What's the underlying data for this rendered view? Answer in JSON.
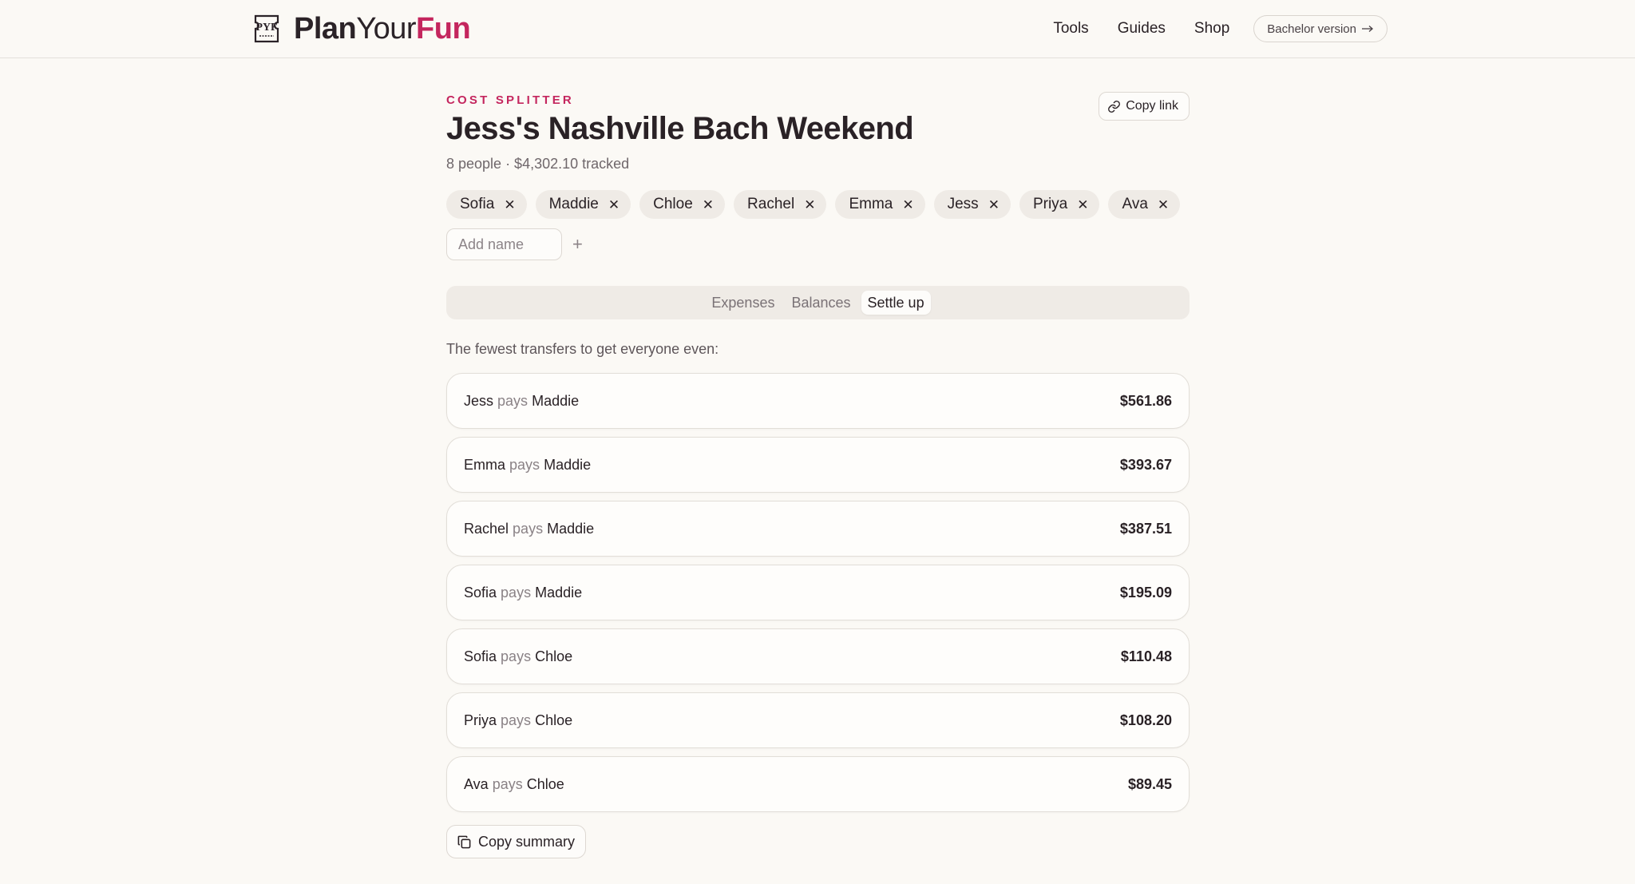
{
  "brand": {
    "logo_mark_text": "PYF",
    "plan": "Plan",
    "your": "Your",
    "fun": "Fun",
    "accent_color": "#c4265e"
  },
  "nav": {
    "links": [
      "Tools",
      "Guides",
      "Shop"
    ],
    "pill_label": "Bachelor version",
    "pill_icon": "arrow-right-icon"
  },
  "page": {
    "eyebrow": "COST SPLITTER",
    "title": "Jess's Nashville Bach Weekend",
    "subtitle": "8 people · $4,302.10 tracked",
    "copy_link_label": "Copy link",
    "copy_link_icon": "link-icon"
  },
  "people": [
    "Sofia",
    "Maddie",
    "Chloe",
    "Rachel",
    "Emma",
    "Jess",
    "Priya",
    "Ava"
  ],
  "add_name": {
    "placeholder": "Add name",
    "value": ""
  },
  "tabs": {
    "items": [
      "Expenses",
      "Balances",
      "Settle up"
    ],
    "active": "Settle up"
  },
  "settle": {
    "intro": "The fewest transfers to get everyone even:",
    "verb": "pays",
    "transfers": [
      {
        "from": "Jess",
        "to": "Maddie",
        "amount": "$561.86"
      },
      {
        "from": "Emma",
        "to": "Maddie",
        "amount": "$393.67"
      },
      {
        "from": "Rachel",
        "to": "Maddie",
        "amount": "$387.51"
      },
      {
        "from": "Sofia",
        "to": "Maddie",
        "amount": "$195.09"
      },
      {
        "from": "Sofia",
        "to": "Chloe",
        "amount": "$110.48"
      },
      {
        "from": "Priya",
        "to": "Chloe",
        "amount": "$108.20"
      },
      {
        "from": "Ava",
        "to": "Chloe",
        "amount": "$89.45"
      }
    ],
    "copy_summary_label": "Copy summary",
    "copy_summary_icon": "copy-icon"
  }
}
